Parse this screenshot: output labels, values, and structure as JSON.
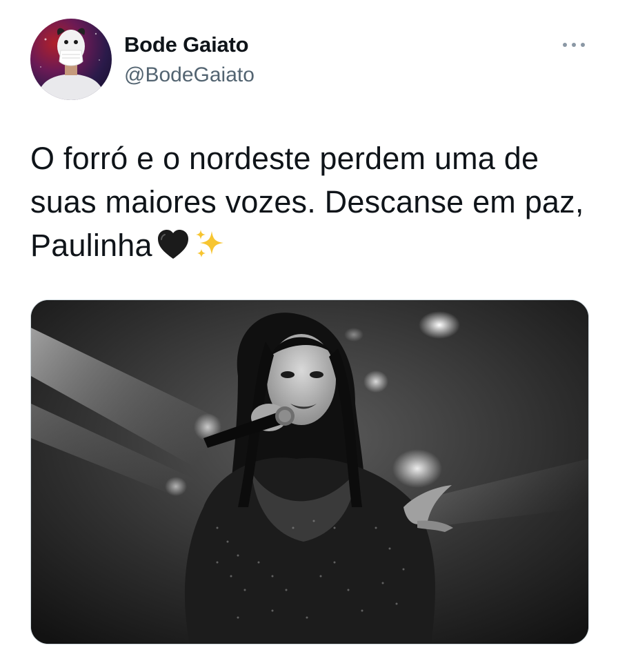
{
  "tweet": {
    "author": {
      "display_name": "Bode Gaiato",
      "handle": "@BodeGaiato"
    },
    "more_icon": "more-horizontal-icon",
    "text": "O forró e o nordeste perdem uma de suas maiores vozes. Descanse em paz, Paulinha",
    "emojis": [
      "black-heart",
      "sparkles"
    ],
    "media": {
      "description_icon": "black-and-white-photo",
      "alt_colors": {
        "border": "#cfd9de"
      }
    }
  },
  "colors": {
    "text": "#0f1419",
    "secondary_text": "#536471",
    "background": "#ffffff"
  }
}
